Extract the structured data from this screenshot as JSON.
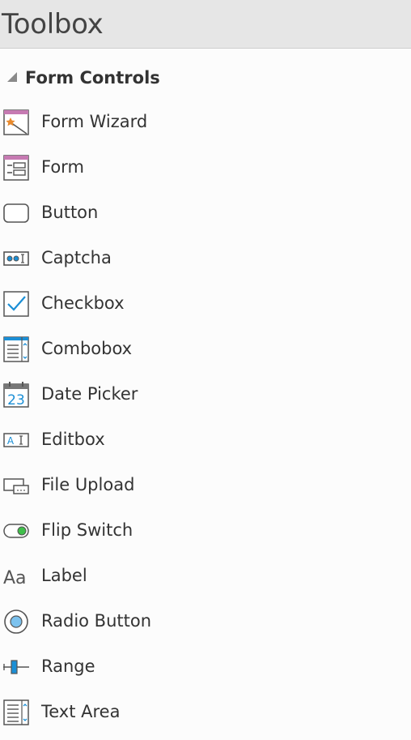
{
  "panel": {
    "title": "Toolbox"
  },
  "section": {
    "label": "Form Controls",
    "expanded": true
  },
  "colors": {
    "header_bg": "#e6e6e6",
    "icon_stroke": "#555555",
    "accent_blue": "#1b8fd6",
    "accent_pink": "#c67ab2",
    "accent_green": "#3fbf4a",
    "accent_orange": "#e88a2e"
  },
  "items": [
    {
      "label": "Form Wizard",
      "icon": "form-wizard-icon"
    },
    {
      "label": "Form",
      "icon": "form-icon"
    },
    {
      "label": "Button",
      "icon": "button-icon"
    },
    {
      "label": "Captcha",
      "icon": "captcha-icon"
    },
    {
      "label": "Checkbox",
      "icon": "checkbox-icon"
    },
    {
      "label": "Combobox",
      "icon": "combobox-icon"
    },
    {
      "label": "Date Picker",
      "icon": "date-picker-icon",
      "icon_text": "23"
    },
    {
      "label": "Editbox",
      "icon": "editbox-icon",
      "icon_text": "A"
    },
    {
      "label": "File Upload",
      "icon": "file-upload-icon"
    },
    {
      "label": "Flip Switch",
      "icon": "flip-switch-icon"
    },
    {
      "label": "Label",
      "icon": "label-icon",
      "icon_text": "Aa"
    },
    {
      "label": "Radio Button",
      "icon": "radio-button-icon"
    },
    {
      "label": "Range",
      "icon": "range-icon"
    },
    {
      "label": "Text Area",
      "icon": "text-area-icon"
    }
  ]
}
